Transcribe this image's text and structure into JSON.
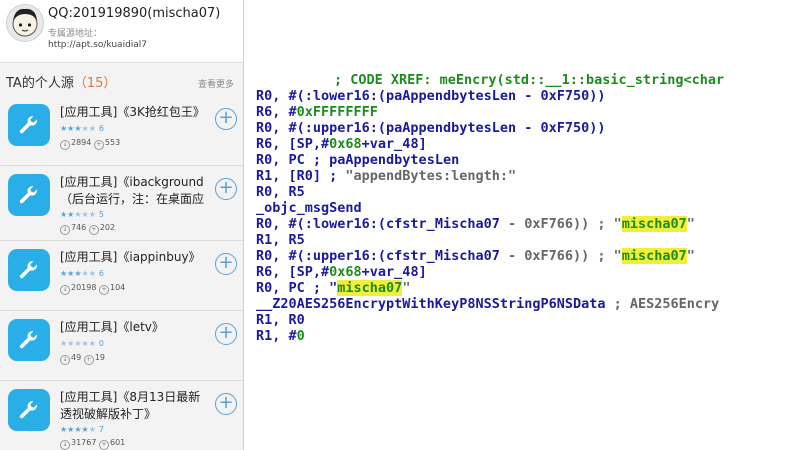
{
  "profile": {
    "name": "QQ:201919890(mischa07)",
    "sub_label": "专属源地址：",
    "url": "http://apt.so/kuaidial7"
  },
  "section": {
    "title_prefix": "TA的个人源",
    "count": "（15）",
    "more": "查看更多"
  },
  "items": [
    {
      "title": "[应用工具]《3K抢红包王》",
      "stars": 3,
      "rating_count": "6",
      "downloads": "2894",
      "installs": "553"
    },
    {
      "title": "[应用工具]《ibackground（后台运行，注：在桌面应",
      "stars": 2,
      "rating_count": "5",
      "downloads": "746",
      "installs": "202"
    },
    {
      "title": "[应用工具]《iappinbuy》",
      "stars": 3,
      "rating_count": "6",
      "downloads": "20198",
      "installs": "104"
    },
    {
      "title": "[应用工具]《letv》",
      "stars": 0,
      "rating_count": "0",
      "downloads": "49",
      "installs": "19"
    },
    {
      "title": "[应用工具]《8月13日最新透视破解版补丁》",
      "stars": 4,
      "rating_count": "7",
      "downloads": "31767",
      "installs": "601"
    }
  ],
  "icons": {
    "app_icon": "wrench-icon",
    "add": "plus-icon",
    "star": "star-icon",
    "download": "download-icon",
    "install": "install-icon"
  },
  "colors": {
    "accent": "#29aee8",
    "count": "#e8743b",
    "code_green": "#1d8c1d",
    "code_blue": "#1a1a9a",
    "highlight": "#f0f03a"
  },
  "code": {
    "l0": "; CODE XREF: meEncry(std::__1::basic_string<char",
    "l1_a": "R0, #(:lower16:(",
    "l1_b": "paAppendbytesLen",
    "l1_c": " - 0xF750))",
    "l2_a": "R6, #",
    "l2_b": "0xFFFFFFFF",
    "l3_a": "R0, #(:upper16:(",
    "l3_b": "paAppendbytesLen",
    "l3_c": " - 0xF750))",
    "l4_a": "R6, [SP,#",
    "l4_b": "0x68",
    "l4_c": "+var_48]",
    "l5_a": "R0, PC ; ",
    "l5_b": "paAppendbytesLen",
    "l6_a": "R1, [R0] ; ",
    "l6_b": "\"appendBytes:length:\"",
    "l7": "R0, R5",
    "l8": "_objc_msgSend",
    "l9_a": "R0, #(:lower16:(",
    "l9_b": "cfstr_Mischa07",
    "l9_c": " - 0xF766)) ; \"",
    "l9_d": "mischa07",
    "l9_e": "\"",
    "l10": "R1, R5",
    "l11_a": "R0, #(:upper16:(",
    "l11_b": "cfstr_Mischa07",
    "l11_c": " - 0xF766)) ; \"",
    "l11_d": "mischa07",
    "l11_e": "\"",
    "l12_a": "R6, [SP,#",
    "l12_b": "0x68",
    "l12_c": "+var_48]",
    "l13_a": "R0, PC ; \"",
    "l13_b": "mischa07",
    "l13_c": "\"",
    "l14_a": "__Z20AES256EncryptWithKeyP8NSStringP6NSData",
    "l14_b": " ; AES256Encry",
    "l15": "R1, R0",
    "l16_a": "R1, #",
    "l16_b": "0"
  }
}
